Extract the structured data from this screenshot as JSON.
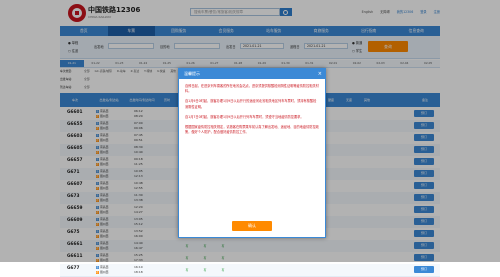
{
  "header": {
    "site_name": "中国铁路12306",
    "site_name_en": "CHINA RAILWAY",
    "search_placeholder": "搜索车票/餐饮/常旅客/相关规章",
    "links": [
      "English",
      "无障碍",
      "我的12306",
      "登录",
      "注册"
    ]
  },
  "nav": [
    "首页",
    "车票",
    "团购服务",
    "会员服务",
    "站车服务",
    "商旅服务",
    "出行指南",
    "信息查询"
  ],
  "query": {
    "radio_oneway": "单程",
    "radio_round": "往返",
    "from_label": "出发地",
    "from_value": "",
    "to_label": "目的地",
    "to_value": "",
    "depart_label": "出发日",
    "depart_value": "2021-01-21",
    "return_label": "返程日",
    "return_value": "2021-01-21",
    "passenger_normal": "普通",
    "passenger_student": "学生",
    "query_button": "查询"
  },
  "dates": [
    "01-21",
    "01-22",
    "01-23",
    "01-24",
    "01-25",
    "01-26",
    "01-27",
    "01-28",
    "01-29",
    "01-30",
    "01-31",
    "02-01",
    "02-02",
    "02-03",
    "02-04",
    "02-05"
  ],
  "filters": {
    "row1_caption": "车次类型:",
    "row1_opts": [
      "全部",
      "GC-高铁/城际",
      "D-动车",
      "Z-直达",
      "T-特快",
      "K-快速",
      "其他"
    ],
    "row2_caption": "出发车站:",
    "row2_opts": [
      "全部"
    ],
    "row3_caption": "到达车站:",
    "row3_opts": [
      "全部"
    ]
  },
  "table": {
    "headers": [
      "车次",
      "出发站/到达站",
      "出发时间/到达时间",
      "历时",
      "商务座",
      "一等座",
      "二等座",
      "高级软卧",
      "软卧",
      "动卧",
      "硬卧",
      "软座",
      "硬座",
      "无座",
      "其他",
      "备注"
    ],
    "book_label": "预订",
    "rows": [
      {
        "train": "G6601",
        "from": "南昌西",
        "to": "赣州西",
        "dep": "06:12",
        "arr": "08:20",
        "seats": [
          "有",
          "有",
          "有"
        ]
      },
      {
        "train": "G6655",
        "from": "南昌西",
        "to": "赣州西",
        "dep": "07:00",
        "arr": "09:06",
        "seats": [
          "有",
          "有",
          "有"
        ]
      },
      {
        "train": "G6603",
        "from": "南昌西",
        "to": "赣州西",
        "dep": "07:45",
        "arr": "09:51",
        "seats": [
          "有",
          "有",
          "有"
        ]
      },
      {
        "train": "G6605",
        "from": "南昌西",
        "to": "赣州西",
        "dep": "08:30",
        "arr": "10:40",
        "seats": [
          "有",
          "有",
          "有"
        ]
      },
      {
        "train": "G6657",
        "from": "南昌西",
        "to": "赣州西",
        "dep": "09:18",
        "arr": "11:25",
        "seats": [
          "有",
          "有",
          "有"
        ]
      },
      {
        "train": "G671",
        "from": "南昌西",
        "to": "赣州西",
        "dep": "10:05",
        "arr": "12:13",
        "seats": [
          "有",
          "有",
          "有"
        ]
      },
      {
        "train": "G6607",
        "from": "南昌西",
        "to": "赣州西",
        "dep": "10:48",
        "arr": "12:55",
        "seats": [
          "有",
          "有",
          "有"
        ]
      },
      {
        "train": "G673",
        "from": "南昌西",
        "to": "赣州西",
        "dep": "11:30",
        "arr": "13:38",
        "seats": [
          "有",
          "有",
          "有"
        ]
      },
      {
        "train": "G6659",
        "from": "南昌西",
        "to": "赣州西",
        "dep": "12:20",
        "arr": "14:27",
        "seats": [
          "有",
          "有",
          "有"
        ]
      },
      {
        "train": "G6609",
        "from": "南昌西",
        "to": "赣州西",
        "dep": "13:05",
        "arr": "15:12",
        "seats": [
          "有",
          "有",
          "有"
        ]
      },
      {
        "train": "G675",
        "from": "南昌西",
        "to": "赣州西",
        "dep": "13:52",
        "arr": "16:00",
        "seats": [
          "有",
          "有",
          "有"
        ]
      },
      {
        "train": "G6661",
        "from": "南昌西",
        "to": "赣州西",
        "dep": "14:40",
        "arr": "16:47",
        "seats": [
          "有",
          "有",
          "有"
        ]
      },
      {
        "train": "G6611",
        "from": "南昌西",
        "to": "赣州西",
        "dep": "15:25",
        "arr": "17:33",
        "seats": [
          "有",
          "有",
          "有"
        ]
      },
      {
        "train": "G677",
        "from": "南昌西",
        "to": "赣州西",
        "dep": "16:10",
        "arr": "18:18",
        "seats": [
          "有",
          "有",
          "有"
        ]
      }
    ]
  },
  "modal": {
    "title": "温馨提示",
    "p1": "自即日起，在进京列车乘客的所在地省会站点，进京须提供核酸检测阴性证明等疫情防控相关材料。",
    "p2": "自1月9日0时起，旅客办理1月9日以后开行的途经河北省相关地区列车车票时，须持有核酸检测阴性证明。",
    "p3": "自1月7日0时起，旅客办理1月9日以后开行列车车票时，须遵守当地疫情防控要求。",
    "p4": "根据国家疫情防控相关规定，请旅客在购票乘车前认真了解出发地、途经地、目的地疫情防控政策，做好个人防护，配合做好疫情防控工作。",
    "ok_label": "确认"
  }
}
